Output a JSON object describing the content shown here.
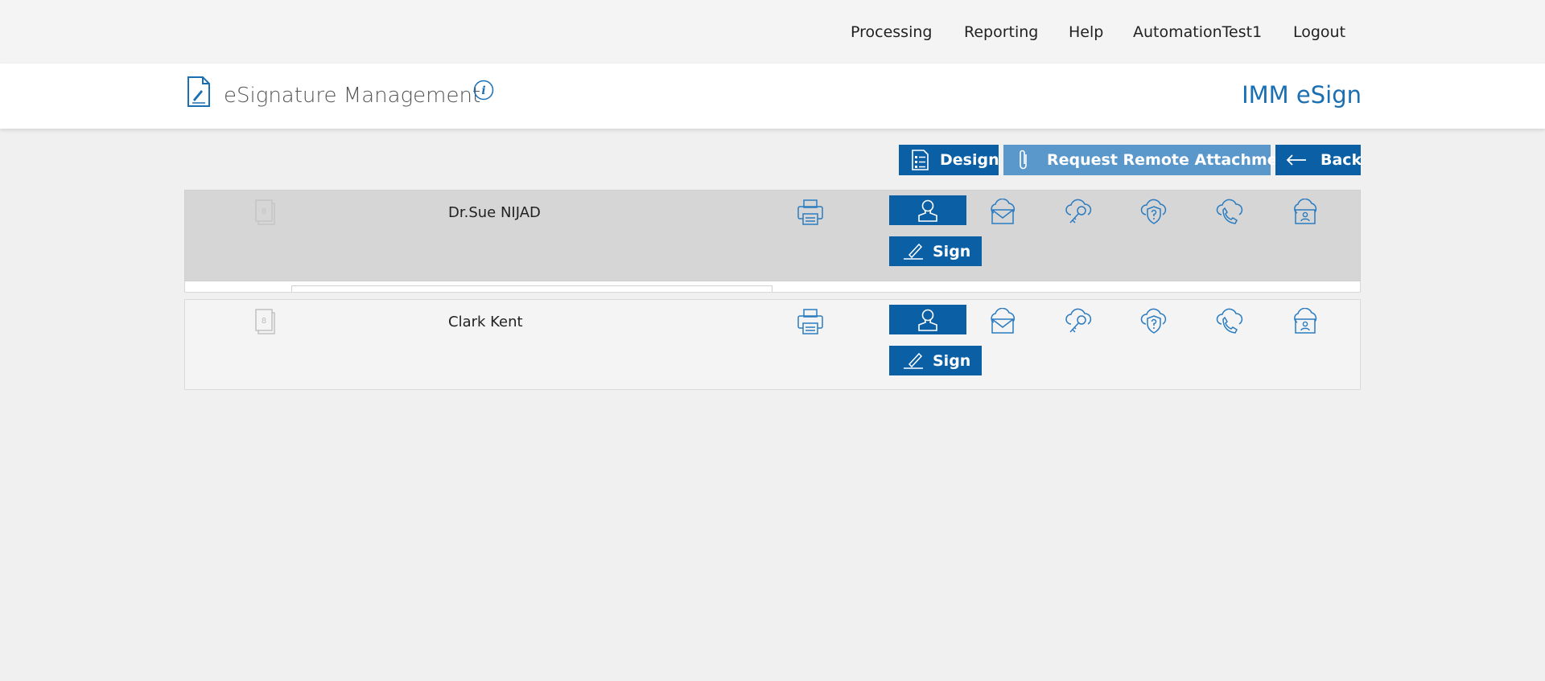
{
  "topnav": {
    "items": [
      {
        "label": "Processing"
      },
      {
        "label": "Reporting"
      },
      {
        "label": "Help"
      },
      {
        "label": "AutomationTest1"
      },
      {
        "label": "Logout"
      }
    ]
  },
  "header": {
    "title": "eSignature Management",
    "brand": "IMM eSign",
    "info_glyph": "i",
    "icons": {
      "document": "document-sign-icon",
      "info": "info-icon"
    }
  },
  "toolbar": {
    "design_label": "Design",
    "attachments_label": "Request Remote Attachments",
    "back_label": "Back"
  },
  "signers": [
    {
      "name": "Dr.Sue NIJAD",
      "page_badge": "8",
      "sign_label": "Sign",
      "selected": true
    },
    {
      "name": "Clark Kent",
      "page_badge": "8",
      "sign_label": "Sign",
      "selected": false
    }
  ],
  "auth_icons": [
    "email-cloud-icon",
    "key-cloud-icon",
    "question-cloud-icon",
    "phone-cloud-icon",
    "id-card-cloud-icon"
  ],
  "colors": {
    "accent": "#0b5fa5",
    "accent_light": "#5a98cc",
    "brand_text": "#1a6fb3",
    "selected_row": "#d6d6d6",
    "row_bg": "#f4f4f4"
  }
}
